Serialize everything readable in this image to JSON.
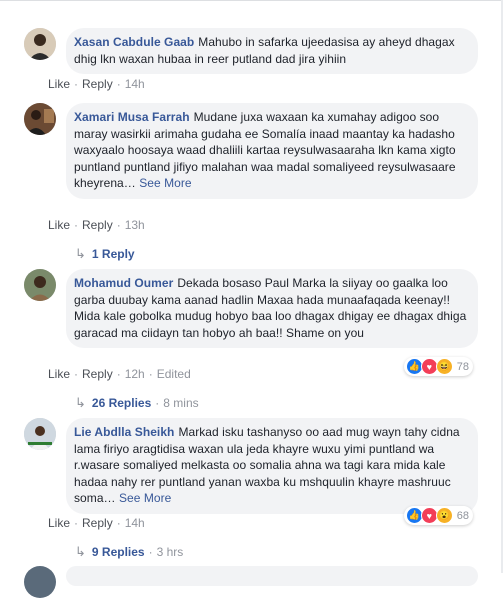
{
  "comments": [
    {
      "author": "Xasan Cabdule Gaab",
      "text": "Mahubo in safarka ujeedasisa ay aheyd dhagax dhig lkn waxan hubaa in reer putland dad jira yihiin",
      "see_more": "",
      "like": "Like",
      "reply": "Reply",
      "time": "14h",
      "edited": "",
      "reaction_count": ""
    },
    {
      "author": "Xamari Musa Farrah",
      "text": "Mudane juxa waxaan ka xumahay adigoo soo maray wasirkii arimaha gudaha ee Somalía inaad maantay ka hadasho waxyaalo hoosaya waad dhaliili kartaa reysulwasaaraha lkn kama xigto puntland puntland jifiyo malahan waa madal somaliyeed reysulwasaare kheyrena…",
      "see_more": "See More",
      "like": "Like",
      "reply": "Reply",
      "time": "13h",
      "edited": "",
      "reaction_count": "",
      "replies_label": "1 Reply",
      "replies_time": ""
    },
    {
      "author": "Mohamud Oumer",
      "text": "Dekada bosaso Paul Marka la siiyay oo gaalka loo garba duubay kama aanad hadlin Maxaa hada munaafaqada keenay!! Mida kale gobolka mudug hobyo baa loo dhagax dhigay ee dhagax dhiga garacad ma ciidayn tan hobyo ah baa!! Shame on you",
      "see_more": "",
      "like": "Like",
      "reply": "Reply",
      "time": "12h",
      "edited": "Edited",
      "reaction_count": "78",
      "reaction_icons": [
        "like-reaction-icon",
        "love-reaction-icon",
        "haha-reaction-icon"
      ],
      "replies_label": "26 Replies",
      "replies_time": "8 mins"
    },
    {
      "author": "Lie Abdlla Sheikh",
      "text": "Markad isku tashanyso oo aad mug wayn tahy cidna lama firiyo aragtidisa waxan ula jeda khayre wuxu yimi puntland wa r.wasare somaliyed melkasta oo somalia ahna wa tagi kara mida kale hadaa nahy rer puntland yanan waxba ku mshquulin khayre mashruuc soma…",
      "see_more": "See More",
      "like": "Like",
      "reply": "Reply",
      "time": "14h",
      "edited": "",
      "reaction_count": "68",
      "reaction_icons": [
        "like-reaction-icon",
        "love-reaction-icon",
        "wow-reaction-icon"
      ],
      "replies_label": "9 Replies",
      "replies_time": "3 hrs"
    }
  ],
  "separator": "·",
  "colors": {
    "author": "#385898",
    "bubble": "#f2f3f5",
    "meta": "#90949c",
    "like": "#1877f2",
    "love": "#f33e58",
    "haha": "#f7b125"
  }
}
